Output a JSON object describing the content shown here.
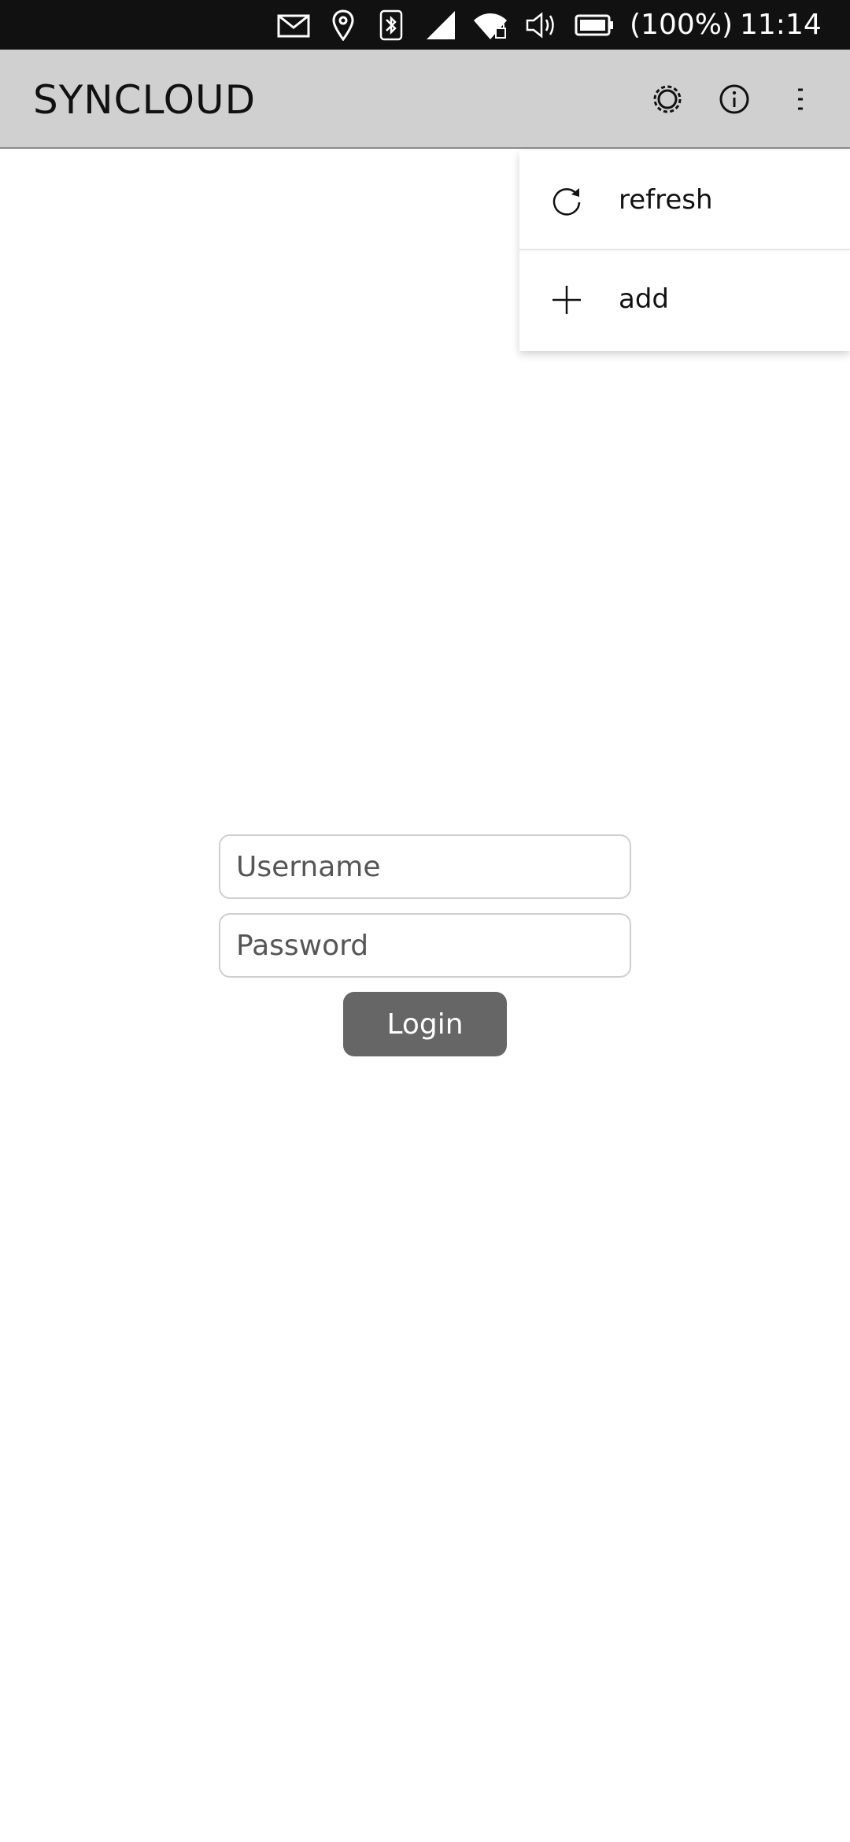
{
  "status_bar": {
    "icons": [
      "mail-icon",
      "location-pin-icon",
      "bluetooth-icon",
      "cellular-signal-icon",
      "wifi-locked-icon",
      "volume-icon",
      "battery-icon"
    ],
    "battery_percent": "(100%)",
    "time": "11:14",
    "background": "#111111"
  },
  "header": {
    "title": "SYNCLOUD",
    "actions": [
      "gear-icon",
      "info-icon",
      "overflow-menu-icon"
    ],
    "background": "#d0d0d0"
  },
  "menu": {
    "items": [
      {
        "icon": "refresh-icon",
        "label": "refresh"
      },
      {
        "icon": "plus-icon",
        "label": "add"
      }
    ]
  },
  "login": {
    "username_placeholder": "Username",
    "password_placeholder": "Password",
    "submit_label": "Login",
    "button_color": "#666666"
  }
}
